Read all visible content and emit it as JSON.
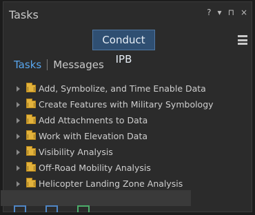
{
  "panel": {
    "title": "Tasks",
    "controls": {
      "help": "?",
      "dropdown": "▾",
      "pin": "⊓",
      "close": "×"
    }
  },
  "command": {
    "label": "Conduct IPB"
  },
  "tabs": [
    {
      "label": "Tasks",
      "active": true
    },
    {
      "label": "Messages",
      "active": false
    }
  ],
  "tasks": [
    {
      "label": "Add, Symbolize, and Time Enable Data"
    },
    {
      "label": "Create Features with Military Symbology"
    },
    {
      "label": "Add Attachments to Data"
    },
    {
      "label": "Work with Elevation Data"
    },
    {
      "label": "Visibility Analysis"
    },
    {
      "label": "Off-Road Mobility Analysis"
    },
    {
      "label": "Helicopter Landing Zone Analysis"
    }
  ],
  "colors": {
    "accent": "#58a6ee",
    "button_bg": "#2f4f72",
    "folder": "#e2b23b"
  }
}
